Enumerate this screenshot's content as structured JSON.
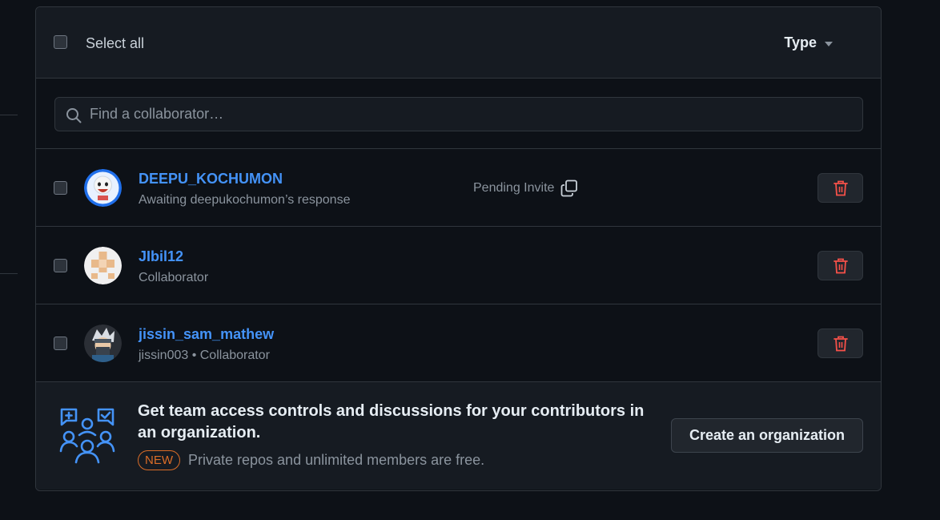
{
  "header": {
    "select_all_label": "Select all",
    "type_filter_label": "Type"
  },
  "search": {
    "placeholder": "Find a collaborator…"
  },
  "collaborators": [
    {
      "name": "DEEPU_KOCHUMON",
      "subtitle": "Awaiting deepukochumon’s response",
      "status": "Pending Invite"
    },
    {
      "name": "JIbil12",
      "subtitle": "Collaborator"
    },
    {
      "name": "jissin_sam_mathew",
      "subtitle": "jissin003 • Collaborator"
    }
  ],
  "promo": {
    "title": "Get team access controls and discussions for your contributors in an organization.",
    "badge": "NEW",
    "subtitle": "Private repos and unlimited members are free.",
    "button_label": "Create an organization"
  },
  "colors": {
    "link": "#4493f8",
    "danger": "#f85149",
    "new_badge": "#db6d28",
    "icon_blue": "#4493f8"
  }
}
